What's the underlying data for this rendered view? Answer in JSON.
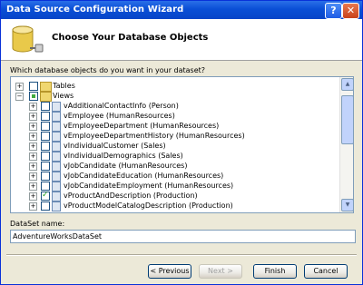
{
  "window": {
    "title": "Data Source Configuration Wizard",
    "help_label": "?",
    "close_label": "✕"
  },
  "header": {
    "title": "Choose Your Database Objects",
    "icon": "database-icon"
  },
  "prompt": "Which database objects do you want in your dataset?",
  "tree": {
    "tables_label": "Tables",
    "views_label": "Views",
    "views": [
      {
        "label": "vAdditionalContactInfo (Person)",
        "checked": false
      },
      {
        "label": "vEmployee (HumanResources)",
        "checked": false
      },
      {
        "label": "vEmployeeDepartment (HumanResources)",
        "checked": false
      },
      {
        "label": "vEmployeeDepartmentHistory (HumanResources)",
        "checked": false
      },
      {
        "label": "vIndividualCustomer (Sales)",
        "checked": false
      },
      {
        "label": "vIndividualDemographics (Sales)",
        "checked": false
      },
      {
        "label": "vJobCandidate (HumanResources)",
        "checked": false
      },
      {
        "label": "vJobCandidateEducation (HumanResources)",
        "checked": false
      },
      {
        "label": "vJobCandidateEmployment (HumanResources)",
        "checked": false
      },
      {
        "label": "vProductAndDescription (Production)",
        "checked": true
      },
      {
        "label": "vProductModelCatalogDescription (Production)",
        "checked": false
      }
    ]
  },
  "dataset": {
    "label": "DataSet name:",
    "value": "AdventureWorksDataSet"
  },
  "buttons": {
    "previous": "< Previous",
    "next": "Next >",
    "finish": "Finish",
    "cancel": "Cancel"
  }
}
